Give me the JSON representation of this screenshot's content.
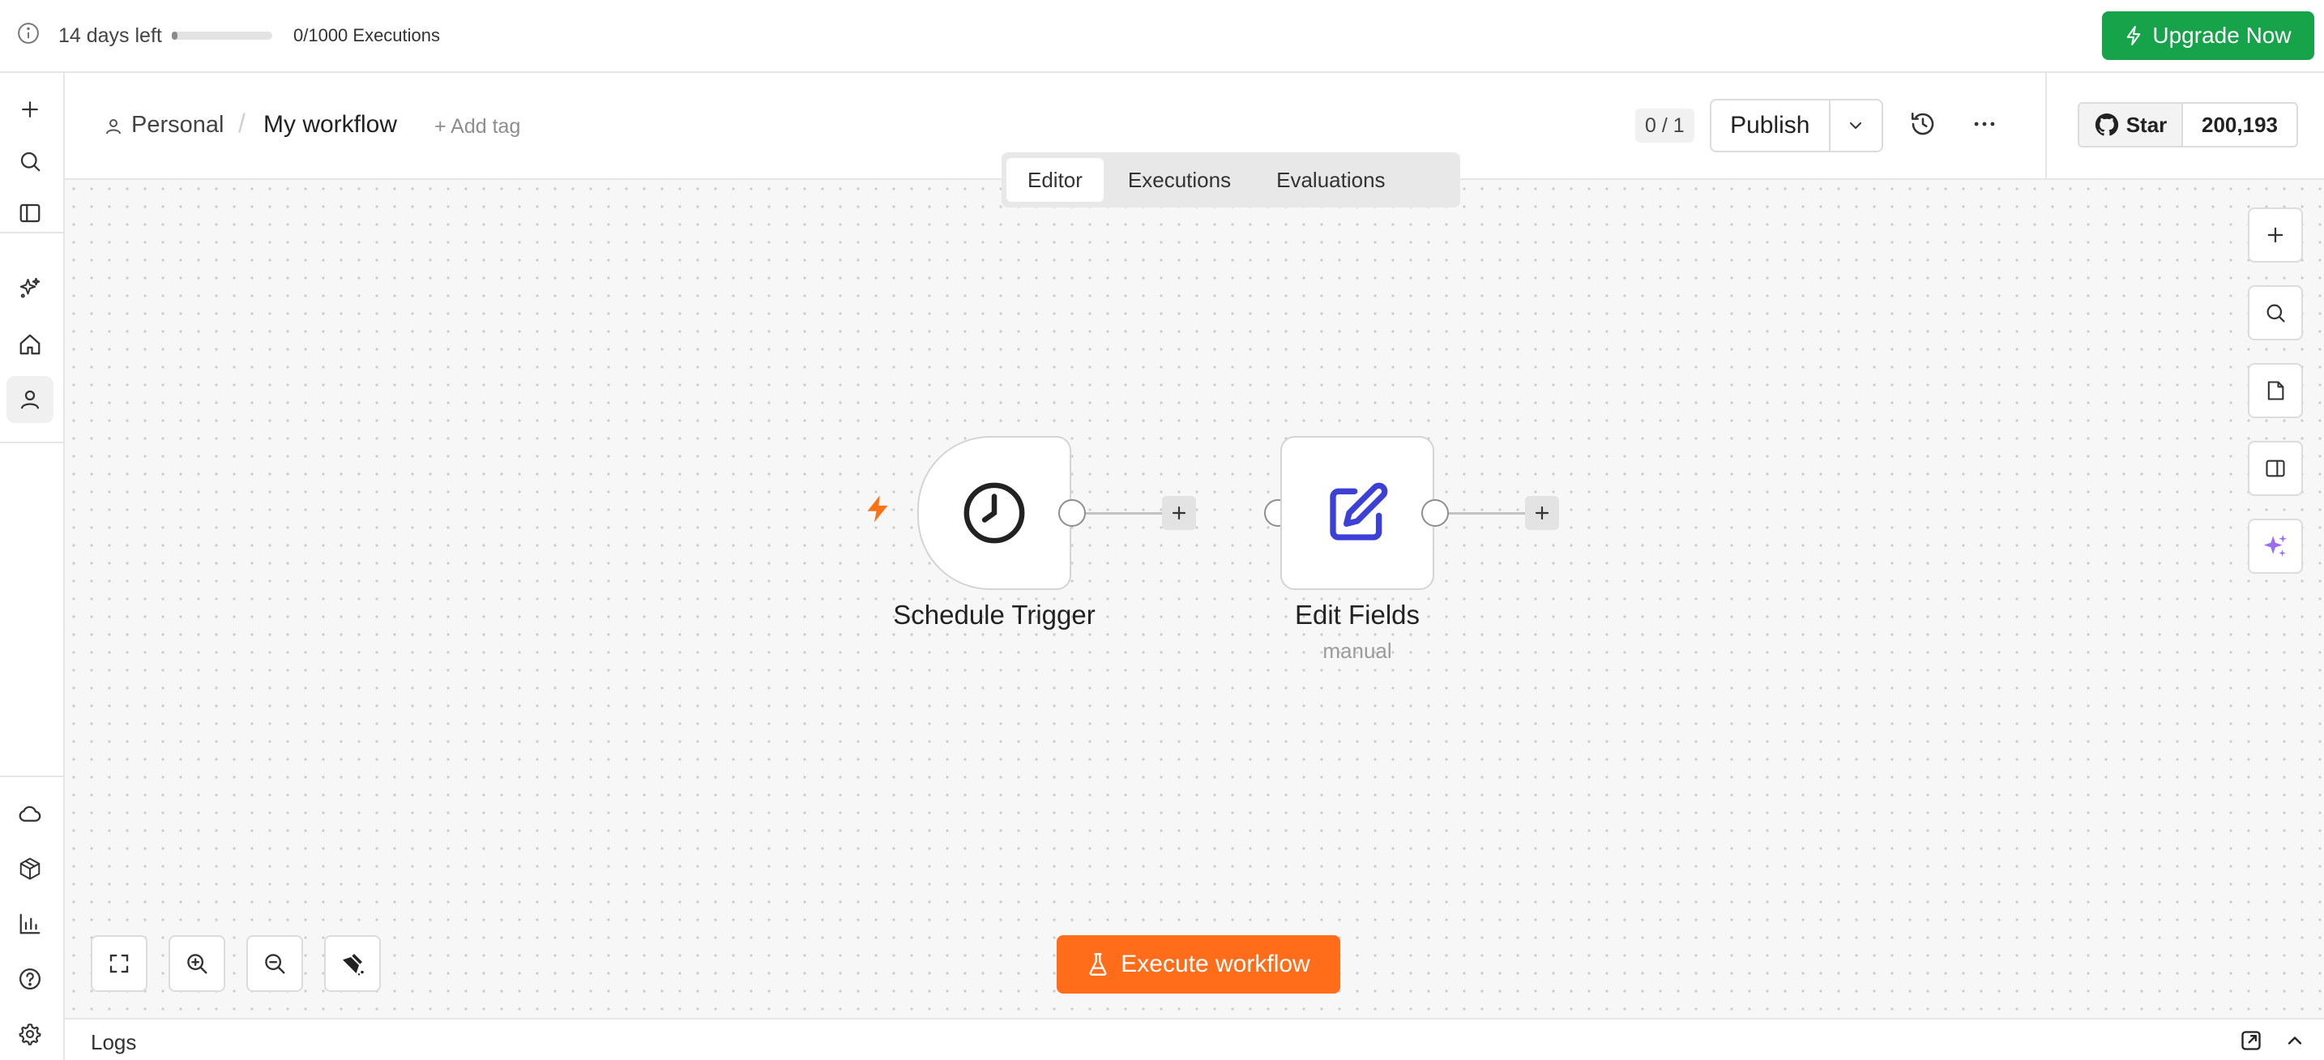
{
  "trial": {
    "days_left": "14 days left",
    "executions": "0/1000 Executions",
    "executions_used_fraction": 0.04,
    "upgrade_label": "Upgrade Now"
  },
  "sidebar": {
    "items": [
      {
        "name": "add",
        "icon": "plus-icon"
      },
      {
        "name": "search",
        "icon": "search-icon"
      },
      {
        "name": "toggle-sidebar",
        "icon": "panel-icon"
      },
      {
        "name": "ai",
        "icon": "sparkles-icon"
      },
      {
        "name": "home",
        "icon": "home-icon"
      },
      {
        "name": "personal",
        "icon": "user-icon",
        "active": true
      }
    ],
    "bottom_items": [
      {
        "name": "cloud",
        "icon": "cloud-icon"
      },
      {
        "name": "templates",
        "icon": "package-icon"
      },
      {
        "name": "insights",
        "icon": "chart-icon"
      },
      {
        "name": "help",
        "icon": "help-icon"
      },
      {
        "name": "settings",
        "icon": "gear-icon"
      }
    ]
  },
  "header": {
    "project": "Personal",
    "separator": "/",
    "workflow_name": "My workflow",
    "add_tag": "+ Add tag",
    "counter": "0 / 1",
    "publish_label": "Publish",
    "github_star": "Star",
    "github_count": "200,193"
  },
  "tabs": [
    {
      "label": "Editor",
      "active": true
    },
    {
      "label": "Executions",
      "active": false
    },
    {
      "label": "Evaluations",
      "active": false
    }
  ],
  "nodes": {
    "trigger": {
      "label": "Schedule Trigger"
    },
    "edit": {
      "label": "Edit Fields",
      "subtitle": "manual"
    }
  },
  "canvas": {
    "execute_label": "Execute workflow"
  },
  "colors": {
    "accent_green": "#17a34a",
    "execute_orange": "#ff6d1a",
    "edit_icon_blue": "#3d40d6",
    "ai_purple": "#9b6df0"
  },
  "logs": {
    "label": "Logs"
  }
}
